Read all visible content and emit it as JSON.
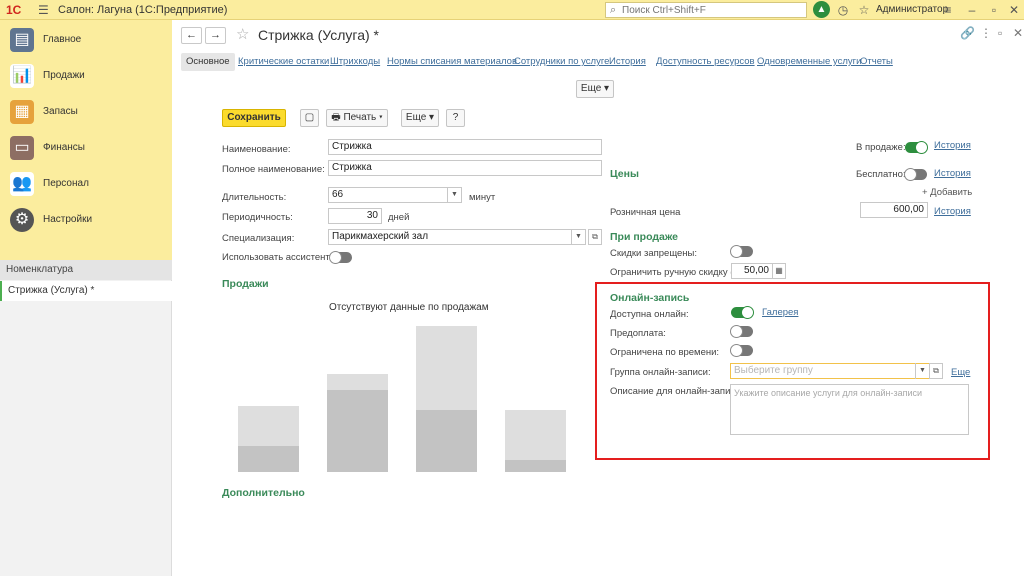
{
  "topbar": {
    "logo": "1С",
    "title": "Салон: Лагуна  (1С:Предприятие)",
    "search_placeholder": "Поиск Ctrl+Shift+F",
    "user": "Администратор"
  },
  "sidebar": {
    "items": [
      {
        "label": "Главное"
      },
      {
        "label": "Продажи"
      },
      {
        "label": "Запасы"
      },
      {
        "label": "Финансы"
      },
      {
        "label": "Персонал"
      },
      {
        "label": "Настройки"
      }
    ],
    "section_title": "Номенклатура",
    "open_item": "Стрижка (Услуга) *"
  },
  "header": {
    "title": "Стрижка (Услуга) *"
  },
  "tabs": [
    "Основное",
    "Критические остатки",
    "Штрихкоды",
    "Нормы списания материалов",
    "Сотрудники по услуге",
    "История",
    "Доступность ресурсов",
    "Одновременные услуги",
    "Отчеты"
  ],
  "more_label": "Еще",
  "toolbar": {
    "save": "Сохранить",
    "print": "Печать",
    "more": "Еще",
    "help": "?"
  },
  "form": {
    "name_label": "Наименование:",
    "name_value": "Стрижка",
    "fullname_label": "Полное наименование:",
    "fullname_value": "Стрижка",
    "duration_label": "Длительность:",
    "duration_value": "66",
    "duration_unit": "минут",
    "period_label": "Периодичность:",
    "period_value": "30",
    "period_unit": "дней",
    "spec_label": "Специализация:",
    "spec_value": "Парикмахерский зал",
    "assistant_label": "Использовать ассистента:"
  },
  "sales": {
    "title": "Продажи",
    "no_data": "Отсутствуют данные по продажам"
  },
  "additional": {
    "title": "Дополнительно"
  },
  "right": {
    "in_sale_label": "В продаже:",
    "in_sale_on": true,
    "history": "История",
    "prices_title": "Цены",
    "free_label": "Бесплатно:",
    "free_on": false,
    "add_label": "+ Добавить",
    "retail_label": "Розничная цена",
    "retail_value": "600,00",
    "at_sale_title": "При продаже",
    "discounts_label": "Скидки запрещены:",
    "discounts_on": false,
    "limit_label": "Ограничить ручную скидку (%):",
    "limit_value": "50,00"
  },
  "online": {
    "title": "Онлайн-запись",
    "available_label": "Доступна онлайн:",
    "available_on": true,
    "gallery": "Галерея",
    "prepay_label": "Предоплата:",
    "prepay_on": false,
    "time_label": "Ограничена по времени:",
    "time_on": false,
    "group_label": "Группа онлайн-записи:",
    "group_placeholder": "Выберите группу",
    "group_more": "Еще",
    "desc_label": "Описание для онлайн-записи:",
    "desc_placeholder": "Укажите описание услуги для онлайн-записи"
  },
  "colors": {
    "accent": "#3a8a59",
    "link": "#3f6e9b",
    "highlight": "#e41e1e",
    "save": "#fbdb2d"
  }
}
